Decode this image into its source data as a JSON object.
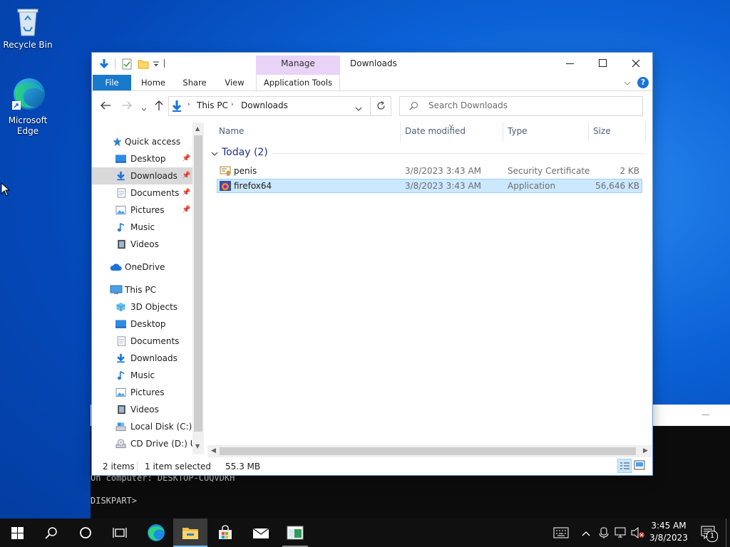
{
  "desktop": {
    "recycle_bin": "Recycle Bin",
    "edge_line1": "Microsoft",
    "edge_line2": "Edge"
  },
  "console": {
    "line1": "On computer: DESKTOP-CUQVDKH",
    "line2": "DISKPART>"
  },
  "explorer": {
    "title": "Downloads",
    "contextual_group": "Manage",
    "ribbon_tabs": [
      "File",
      "Home",
      "Share",
      "View",
      "Application Tools"
    ],
    "breadcrumb": [
      "This PC",
      "Downloads"
    ],
    "search_placeholder": "Search Downloads",
    "nav": {
      "quick_access": "Quick access",
      "qa_items": [
        "Desktop",
        "Downloads",
        "Documents",
        "Pictures",
        "Music",
        "Videos"
      ],
      "onedrive": "OneDrive",
      "this_pc": "This PC",
      "pc_items": [
        "3D Objects",
        "Desktop",
        "Documents",
        "Downloads",
        "Music",
        "Pictures",
        "Videos",
        "Local Disk (C:)",
        "CD Drive (D:) Ub"
      ]
    },
    "columns": [
      "Name",
      "Date modified",
      "Type",
      "Size"
    ],
    "group_header": "Today (2)",
    "files": [
      {
        "name": "penis",
        "date": "3/8/2023 3:43 AM",
        "type": "Security Certificate",
        "size": "2 KB"
      },
      {
        "name": "firefox64",
        "date": "3/8/2023 3:43 AM",
        "type": "Application",
        "size": "56,646 KB"
      }
    ],
    "status": {
      "items": "2 items",
      "selected": "1 item selected",
      "size": "55.3 MB"
    }
  },
  "taskbar": {
    "time": "3:45 AM",
    "date": "3/8/2023",
    "notification_count": "1"
  },
  "colors": {
    "accent": "#0078d7",
    "selection": "#cce8ff",
    "contextual": "#e9d3f7"
  }
}
